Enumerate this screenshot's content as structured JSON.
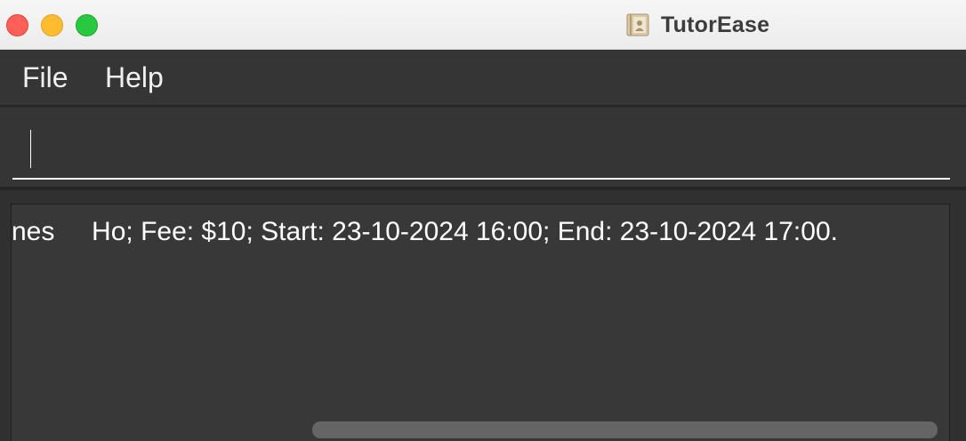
{
  "window": {
    "title": "TutorEase",
    "app_icon": "contacts-book-icon",
    "traffic_lights": {
      "close_color": "#fe5f57",
      "minimize_color": "#febc2e",
      "maximize_color": "#28c840"
    }
  },
  "menu": {
    "file_label": "File",
    "help_label": "Help"
  },
  "command_box": {
    "value": "",
    "placeholder": ""
  },
  "result_display": {
    "text": "nes     Ho; Fee: $10; Start: 23-10-2024 16:00; End: 23-10-2024 17:00."
  }
}
